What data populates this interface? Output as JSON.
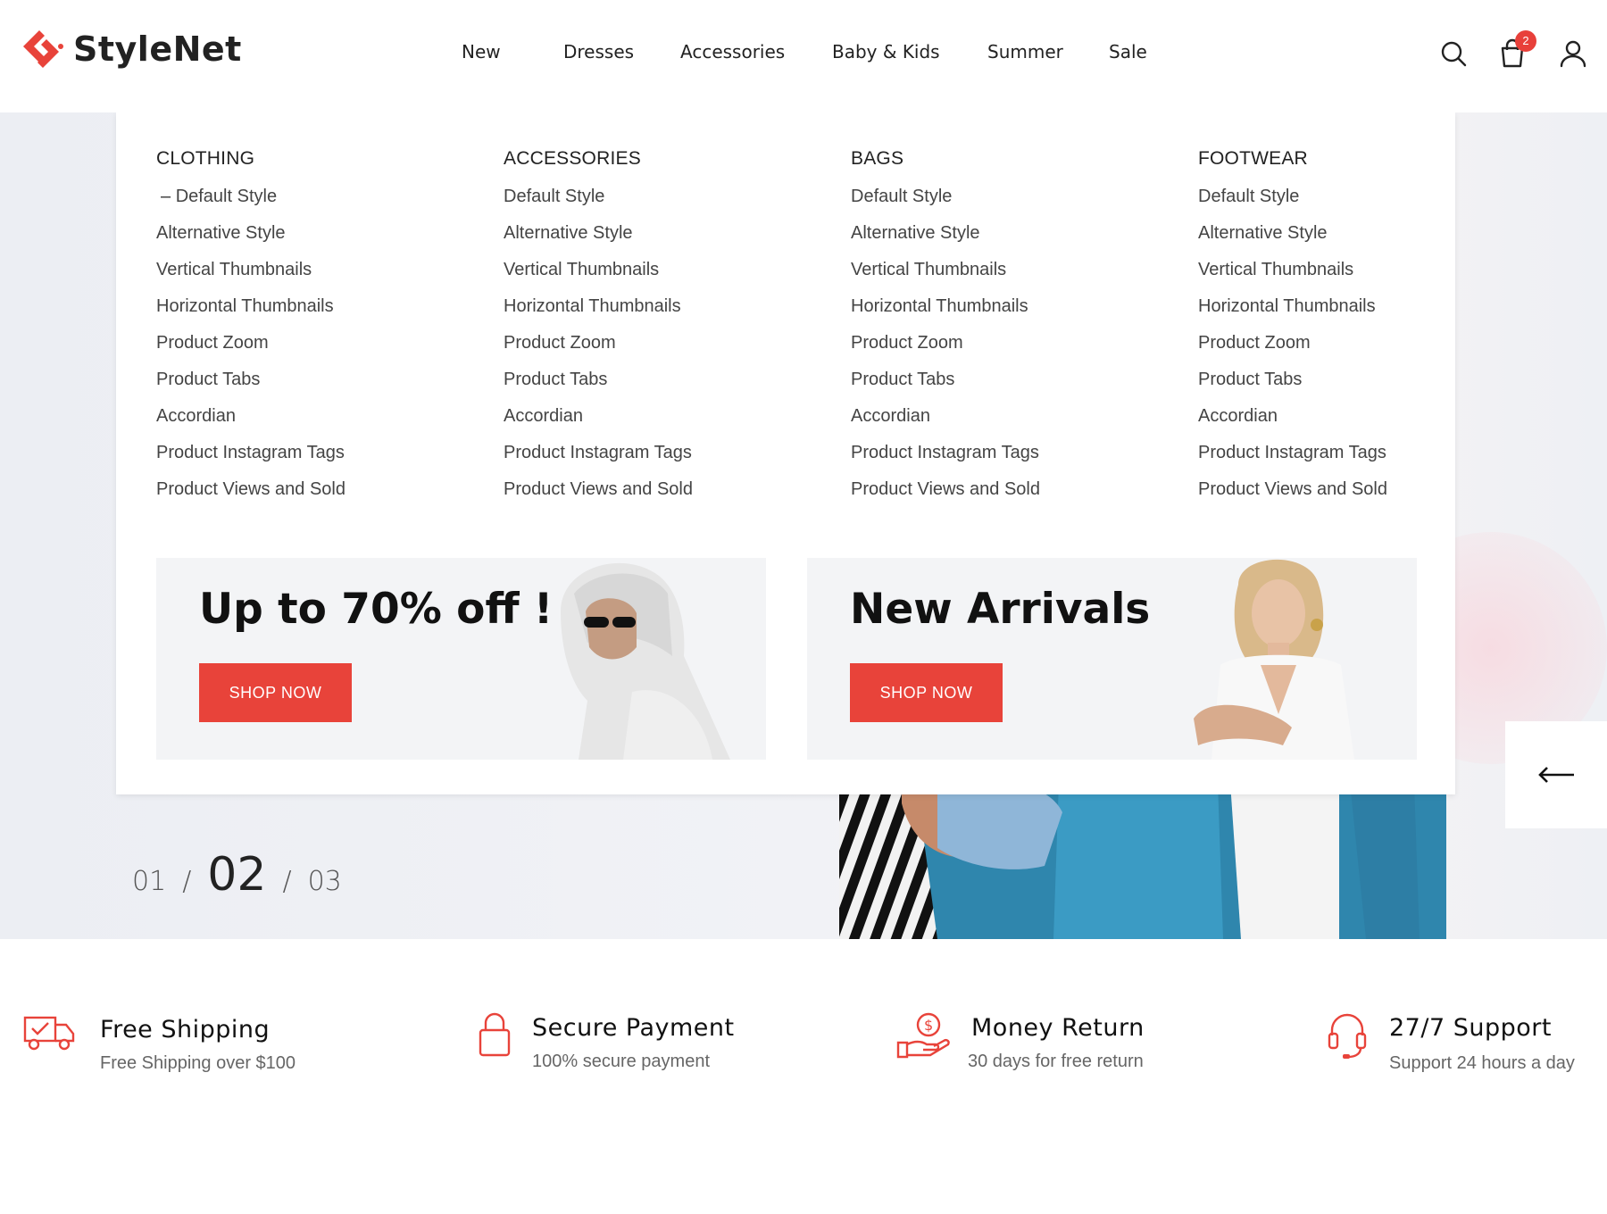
{
  "header": {
    "logo_text": "StyleNet",
    "nav": [
      "New",
      "Dresses",
      "Accessories",
      "Baby & Kids",
      "Summer",
      "Sale"
    ],
    "cart_count": "2",
    "icons": [
      "search-icon",
      "shopping-bag-icon",
      "user-icon"
    ]
  },
  "menu": {
    "columns": [
      {
        "title": "CLOTHING",
        "items": [
          "Default Style",
          "Alternative Style",
          "Vertical Thumbnails",
          "Horizontal Thumbnails",
          "Product Zoom",
          "Product Tabs",
          "Accordian",
          "Product Instagram Tags",
          "Product Views and Sold"
        ]
      },
      {
        "title": "ACCESSORIES",
        "items": [
          "Default Style",
          "Alternative Style",
          "Vertical Thumbnails",
          "Horizontal Thumbnails",
          "Product Zoom",
          "Product Tabs",
          "Accordian",
          "Product Instagram Tags",
          "Product Views and Sold"
        ]
      },
      {
        "title": "BAGS",
        "items": [
          "Default Style",
          "Alternative Style",
          "Vertical Thumbnails",
          "Horizontal Thumbnails",
          "Product Zoom",
          "Product Tabs",
          "Accordian",
          "Product Instagram Tags",
          "Product Views and Sold"
        ]
      },
      {
        "title": "FOOTWEAR",
        "items": [
          "Default Style",
          "Alternative Style",
          "Vertical Thumbnails",
          "Horizontal Thumbnails",
          "Product Zoom",
          "Product Tabs",
          "Accordian",
          "Product Instagram Tags",
          "Product Views and Sold"
        ]
      }
    ],
    "promos": [
      {
        "title": "Up to 70% off !",
        "button": "SHOP NOW"
      },
      {
        "title": "New Arrivals",
        "button": "SHOP NOW"
      }
    ]
  },
  "slider": {
    "prev": "01",
    "current": "02",
    "total": "03",
    "sep": "/"
  },
  "features": [
    {
      "icon": "delivery-truck-icon",
      "title": "Free Shipping",
      "subtitle": "Free Shipping over $100"
    },
    {
      "icon": "lock-icon",
      "title": "Secure Payment",
      "subtitle": "100% secure payment"
    },
    {
      "icon": "money-hand-icon",
      "title": "Money Return",
      "subtitle": "30 days for free return"
    },
    {
      "icon": "headset-icon",
      "title": "27/7 Support",
      "subtitle": "Support 24 hours a day"
    }
  ],
  "colors": {
    "accent": "#e8433a",
    "text": "#222222",
    "muted": "#666666"
  }
}
